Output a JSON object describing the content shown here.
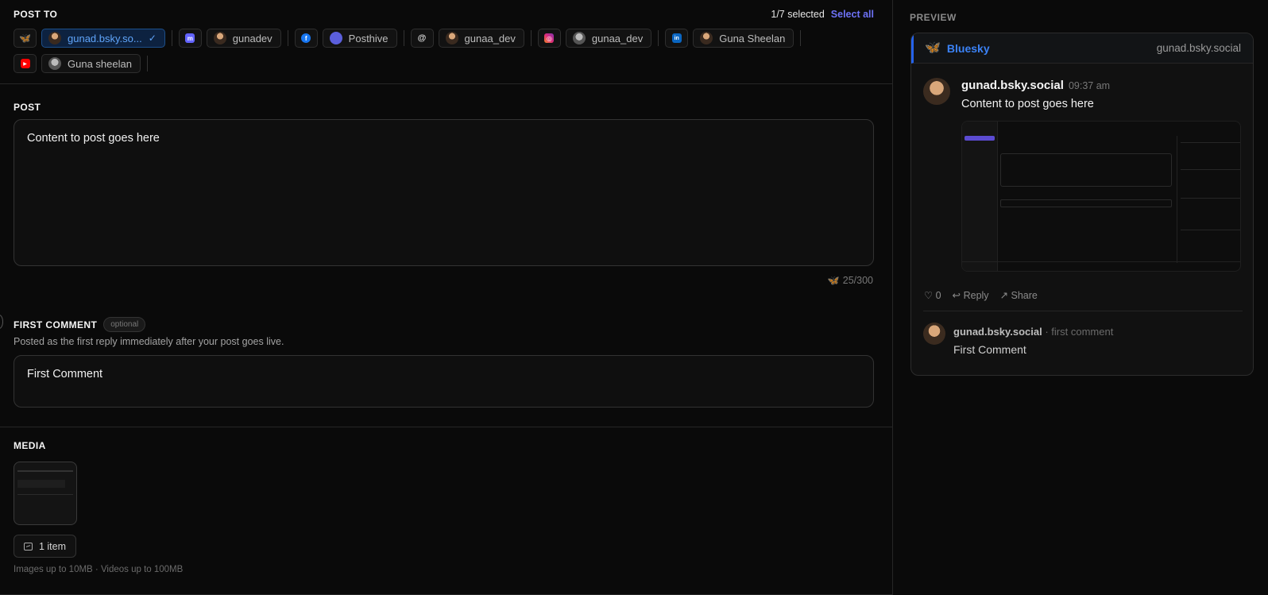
{
  "post_to": {
    "title": "POST TO",
    "selected_count": "1/7 selected",
    "select_all": "Select all",
    "platforms": [
      {
        "platform": "bluesky",
        "icon": "butterfly-icon",
        "color": "#1185fe",
        "glyph": "🦋",
        "account": "gunad.bsky.so...",
        "selected": true
      },
      {
        "platform": "mastodon",
        "icon": "mastodon-icon",
        "color": "#6364ff",
        "glyph": "m",
        "account": "gunadev",
        "selected": false
      },
      {
        "platform": "facebook",
        "icon": "facebook-icon",
        "color": "#1877f2",
        "glyph": "f",
        "account": "Posthive",
        "selected": false
      },
      {
        "platform": "threads",
        "icon": "threads-icon",
        "color": "#222222",
        "glyph": "@",
        "account": "gunaa_dev",
        "selected": false
      },
      {
        "platform": "instagram",
        "icon": "instagram-icon",
        "color": "#e1306c",
        "glyph": "◎",
        "account": "gunaa_dev",
        "selected": false
      },
      {
        "platform": "linkedin",
        "icon": "linkedin-icon",
        "color": "#0a66c2",
        "glyph": "in",
        "account": "Guna Sheelan",
        "selected": false
      },
      {
        "platform": "youtube",
        "icon": "youtube-icon",
        "color": "#ff0000",
        "glyph": "▶",
        "account": "Guna sheelan",
        "selected": false
      }
    ]
  },
  "post": {
    "title": "POST",
    "content": "Content to post goes here",
    "char_count": "25/300"
  },
  "first_comment": {
    "title": "FIRST COMMENT",
    "optional_badge": "optional",
    "description": "Posted as the first reply immediately after your post goes live.",
    "content": "First Comment"
  },
  "media": {
    "title": "MEDIA",
    "item_count_label": "1 item",
    "note": "Images up to 10MB · Videos up to 100MB"
  },
  "preview": {
    "title": "PREVIEW",
    "network": "Bluesky",
    "network_color": "#3b82f6",
    "handle": "gunad.bsky.social",
    "author": "gunad.bsky.social",
    "time": "09:37 am",
    "text": "Content to post goes here",
    "likes": "♡ 0",
    "reply": "↩ Reply",
    "share": "↗ Share",
    "comment_author": "gunad.bsky.social",
    "comment_note": " · first comment",
    "comment_text": "First Comment"
  }
}
